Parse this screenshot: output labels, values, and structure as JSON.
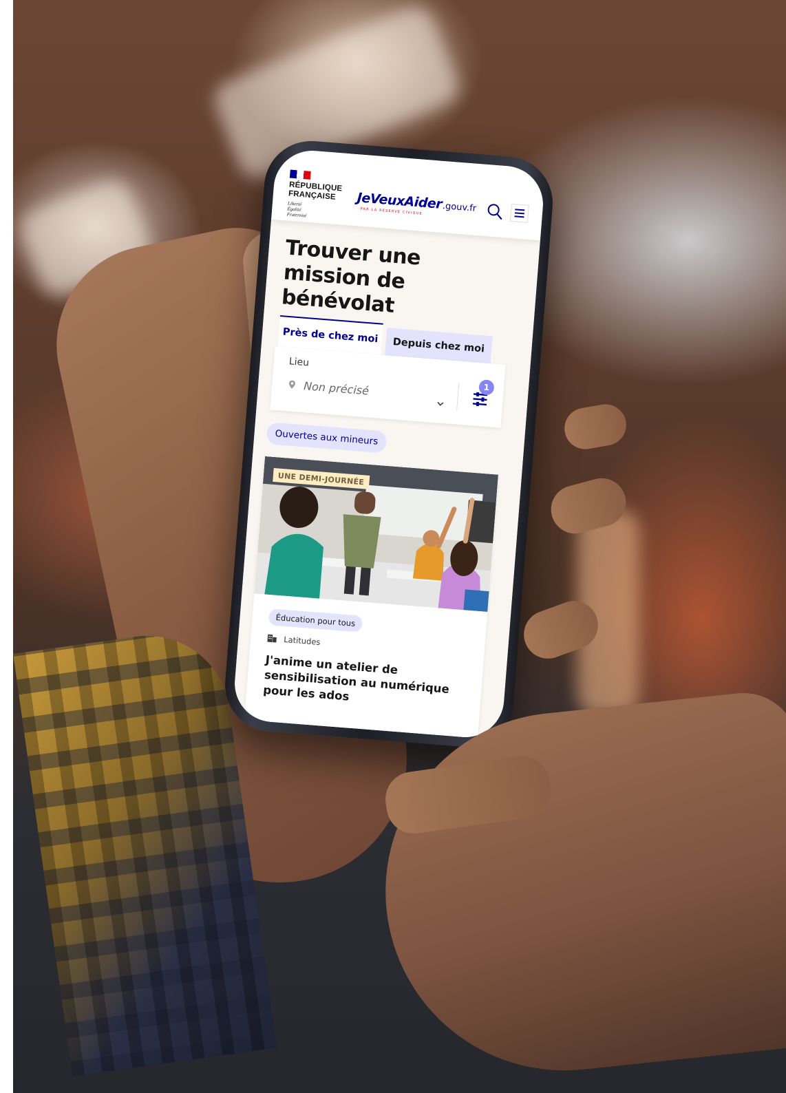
{
  "header": {
    "republic_line1": "RÉPUBLIQUE",
    "republic_line2": "FRANÇAISE",
    "motto": [
      "Liberté",
      "Égalité",
      "Fraternité"
    ],
    "brand_name": "JeVeuxAider",
    "brand_suffix": ".gouv.fr",
    "brand_tagline": "PAR LA RÉSERVE CIVIQUE",
    "search_icon": "search-icon",
    "menu_icon": "menu-icon"
  },
  "page": {
    "title": "Trouver une mission de bénévolat"
  },
  "tabs": [
    {
      "label": "Près de chez moi",
      "active": true
    },
    {
      "label": "Depuis chez moi",
      "active": false
    }
  ],
  "search": {
    "location_label": "Lieu",
    "location_value": "Non précisé",
    "filter_count": "1"
  },
  "filters": {
    "minors_chip": "Ouvertes aux mineurs"
  },
  "mission": {
    "duration_badge": "UNE DEMI-JOURNÉE",
    "category": "Éducation pour tous",
    "organization": "Latitudes",
    "title": "J'anime un atelier de sensibilisation au numérique pour les ados"
  },
  "colors": {
    "accent": "#000091",
    "chip_bg": "#e3e3fd",
    "badge": "#8585f6",
    "page_bg": "#f9f6f2"
  }
}
